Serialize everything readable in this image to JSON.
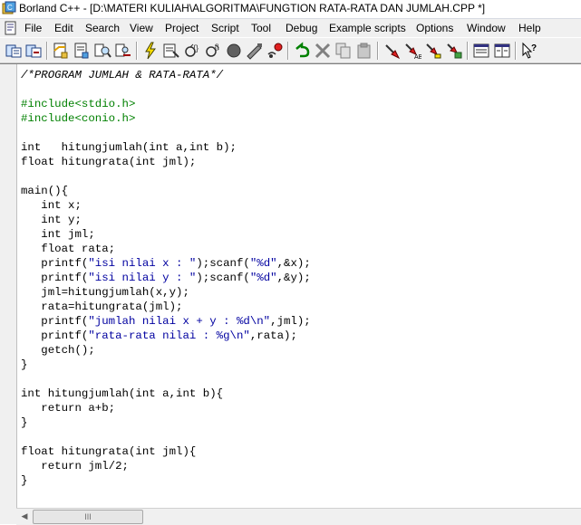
{
  "window": {
    "title": "Borland C++ - [D:\\MATERI KULIAH\\ALGORITMA\\FUNGTION RATA-RATA DAN JUMLAH.CPP *]"
  },
  "menu": {
    "items": [
      {
        "label": "File",
        "accel": "F",
        "rest": "ile"
      },
      {
        "label": "Edit",
        "accel": "E",
        "rest": "dit"
      },
      {
        "label": "Search",
        "accel": "S",
        "rest": "earch"
      },
      {
        "label": "View",
        "accel": "V",
        "rest": "iew"
      },
      {
        "label": "Project",
        "accel": "P",
        "rest": "roject"
      },
      {
        "label": "Script",
        "accel": "S",
        "rest": "cript"
      },
      {
        "label": "Tool",
        "accel": "T",
        "rest": "ool"
      },
      {
        "label": "Debug",
        "accel": "D",
        "rest": "ebug"
      },
      {
        "label": "Example scripts",
        "accel": "E",
        "rest": "xample scripts"
      },
      {
        "label": "Options",
        "accel": "O",
        "rest": "ptions"
      },
      {
        "label": "Window",
        "accel": "W",
        "rest": "indow"
      },
      {
        "label": "Help",
        "accel": "H",
        "rest": "elp"
      }
    ]
  },
  "toolbar": {
    "buttons": [
      {
        "icon": "open-project-icon"
      },
      {
        "icon": "save-project-icon"
      },
      {
        "icon": "open-file-icon"
      },
      {
        "icon": "save-file-icon"
      },
      {
        "icon": "search-icon"
      },
      {
        "icon": "replace-icon"
      },
      {
        "icon": "make-icon"
      },
      {
        "icon": "build-icon"
      },
      {
        "icon": "compile-icon"
      },
      {
        "icon": "step-over-icon"
      },
      {
        "icon": "trace-into-icon"
      },
      {
        "icon": "stop-icon"
      },
      {
        "icon": "run-to-icon"
      },
      {
        "icon": "breakpoint-icon"
      },
      {
        "icon": "undo-icon"
      },
      {
        "icon": "cut-icon"
      },
      {
        "icon": "copy-icon"
      },
      {
        "icon": "paste-icon"
      },
      {
        "icon": "inspect-icon"
      },
      {
        "icon": "evaluate-icon"
      },
      {
        "icon": "watch-icon"
      },
      {
        "icon": "message-icon"
      },
      {
        "icon": "class-expert-icon"
      },
      {
        "icon": "tile-icon"
      },
      {
        "icon": "context-help-icon"
      }
    ]
  },
  "editor": {
    "lines": [
      [
        {
          "t": "/*PROGRAM JUMLAH & RATA-RATA*/",
          "c": "comment"
        }
      ],
      [
        {
          "t": ""
        }
      ],
      [
        {
          "t": "#include<stdio.h>",
          "c": "pre"
        }
      ],
      [
        {
          "t": "#include<conio.h>",
          "c": "pre"
        }
      ],
      [
        {
          "t": ""
        }
      ],
      [
        {
          "t": "int   hitungjumlah(int a,int b);"
        }
      ],
      [
        {
          "t": "float hitungrata(int jml);"
        }
      ],
      [
        {
          "t": ""
        }
      ],
      [
        {
          "t": "main(){"
        }
      ],
      [
        {
          "t": "   int x;"
        }
      ],
      [
        {
          "t": "   int y;"
        }
      ],
      [
        {
          "t": "   int jml;"
        }
      ],
      [
        {
          "t": "   float rata;"
        }
      ],
      [
        {
          "t": "   printf("
        },
        {
          "t": "\"isi nilai x : \"",
          "c": "str"
        },
        {
          "t": ");scanf("
        },
        {
          "t": "\"%d\"",
          "c": "str"
        },
        {
          "t": ",&x);"
        }
      ],
      [
        {
          "t": "   printf("
        },
        {
          "t": "\"isi nilai y : \"",
          "c": "str"
        },
        {
          "t": ");scanf("
        },
        {
          "t": "\"%d\"",
          "c": "str"
        },
        {
          "t": ",&y);"
        }
      ],
      [
        {
          "t": "   jml=hitungjumlah(x,y);"
        }
      ],
      [
        {
          "t": "   rata=hitungrata(jml);"
        }
      ],
      [
        {
          "t": "   printf("
        },
        {
          "t": "\"jumlah nilai x + y : %d\\n\"",
          "c": "str"
        },
        {
          "t": ",jml);"
        }
      ],
      [
        {
          "t": "   printf("
        },
        {
          "t": "\"rata-rata nilai : %g\\n\"",
          "c": "str"
        },
        {
          "t": ",rata);"
        }
      ],
      [
        {
          "t": "   getch();"
        }
      ],
      [
        {
          "t": "}"
        }
      ],
      [
        {
          "t": ""
        }
      ],
      [
        {
          "t": "int hitungjumlah(int a,int b){"
        }
      ],
      [
        {
          "t": "   return a+b;"
        }
      ],
      [
        {
          "t": "}"
        }
      ],
      [
        {
          "t": ""
        }
      ],
      [
        {
          "t": "float hitungrata(int jml){"
        }
      ],
      [
        {
          "t": "   return jml/2;"
        }
      ],
      [
        {
          "t": "}"
        }
      ]
    ]
  },
  "scrollbar": {
    "thumb_grip": "III"
  }
}
